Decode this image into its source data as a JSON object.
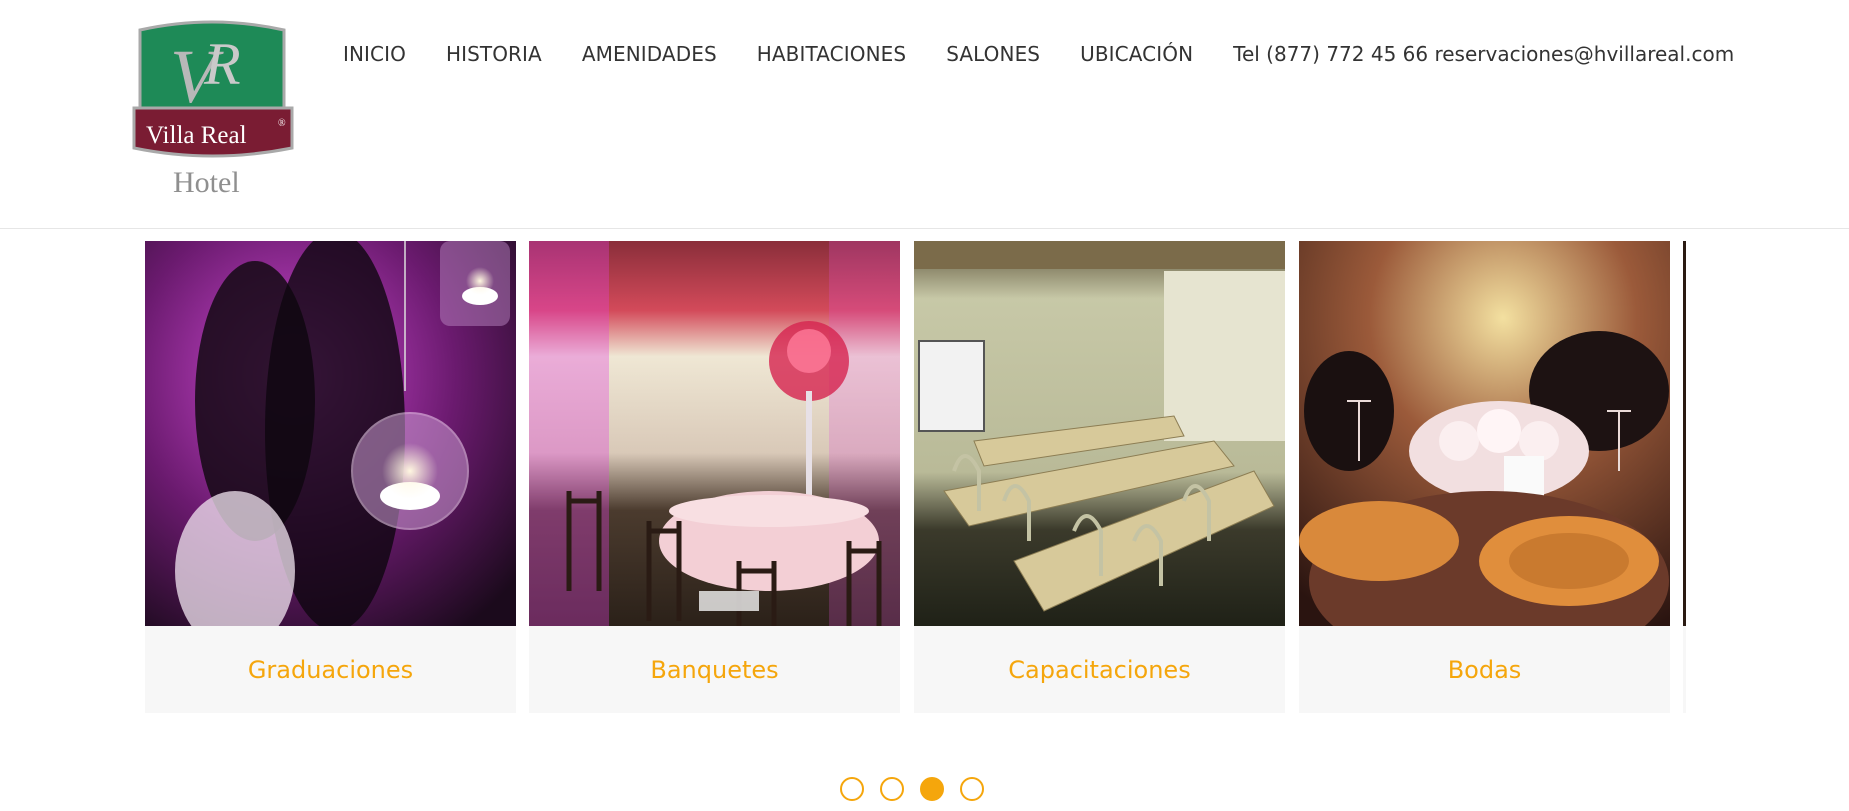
{
  "brand": {
    "monogram": "VR",
    "name": "Villa Real",
    "registered_mark": "®",
    "subtitle": "Hotel",
    "colors": {
      "green": "#1e8a57",
      "maroon": "#7a1c33",
      "grey": "#8f8f8f"
    }
  },
  "nav": {
    "items": [
      {
        "label": "INICIO"
      },
      {
        "label": "HISTORIA"
      },
      {
        "label": "AMENIDADES"
      },
      {
        "label": "HABITACIONES"
      },
      {
        "label": "SALONES"
      },
      {
        "label": "UBICACIÓN"
      }
    ],
    "contact": "Tel (877) 772 45 66 reservaciones@hvillareal.com"
  },
  "carousel": {
    "cards": [
      {
        "title": "Graduaciones"
      },
      {
        "title": "Banquetes"
      },
      {
        "title": "Capacitaciones"
      },
      {
        "title": "Bodas"
      }
    ],
    "pagination": {
      "total": 4,
      "active_index": 2
    }
  },
  "colors": {
    "accent": "#f5a60c",
    "text": "#333333",
    "card_bg": "#f7f7f7"
  }
}
